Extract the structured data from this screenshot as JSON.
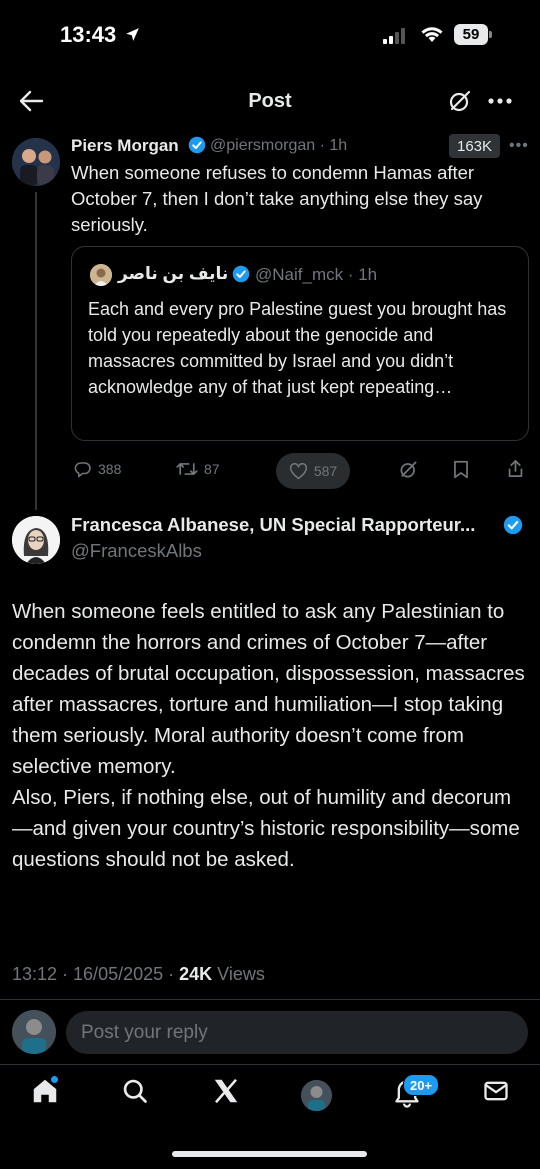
{
  "status_bar": {
    "time": "13:43",
    "battery": "59"
  },
  "header": {
    "title": "Post"
  },
  "quoted_post": {
    "author_name": "Piers Morgan",
    "meta": "@piersmorgan · 1h",
    "views_badge": "163K",
    "text": "When someone refuses to condemn Hamas after October 7, then I don’t take anything else they say seriously.",
    "quote": {
      "author_name": "نايف بن ناصر",
      "meta": "@Naif_mck · 1h",
      "text": "Each and every pro Palestine guest you brought has told you repeatedly about the genocide and massacres committed by Israel and you didn’t acknowledge any of that just kept repeating…"
    },
    "actions": {
      "replies": "388",
      "reposts": "87",
      "likes": "587"
    }
  },
  "main_post": {
    "author_name": "Francesca Albanese, UN Special Rapporteur...",
    "handle": "@FranceskAlbs",
    "paragraph_1": "When someone feels entitled to ask any Palestinian to condemn the horrors and crimes of October 7—after decades of brutal occupation, dispossession, massacres after massacres, torture and humiliation—I stop taking them seriously. Moral authority doesn’t come from selective memory.",
    "paragraph_2": "Also, Piers, if nothing else, out of humility and decorum—and given your country’s historic responsibility—some questions should not be asked.",
    "timestamp": "13:12 · 16/05/2025 · ",
    "views_count": "24K",
    "views_label": " Views"
  },
  "reply_bar": {
    "placeholder": "Post your reply"
  },
  "tab_bar": {
    "notifications_badge": "20+"
  },
  "colors": {
    "accent": "#1d9bf0",
    "background": "#000000",
    "text_secondary": "#71767b"
  },
  "icons": [
    "back-arrow-icon",
    "grok-icon",
    "more-icon",
    "verified-badge-icon",
    "reply-icon",
    "repost-icon",
    "like-icon",
    "bookmark-icon",
    "share-icon",
    "home-icon",
    "search-icon",
    "x-logo-icon",
    "bell-icon",
    "mail-icon"
  ]
}
